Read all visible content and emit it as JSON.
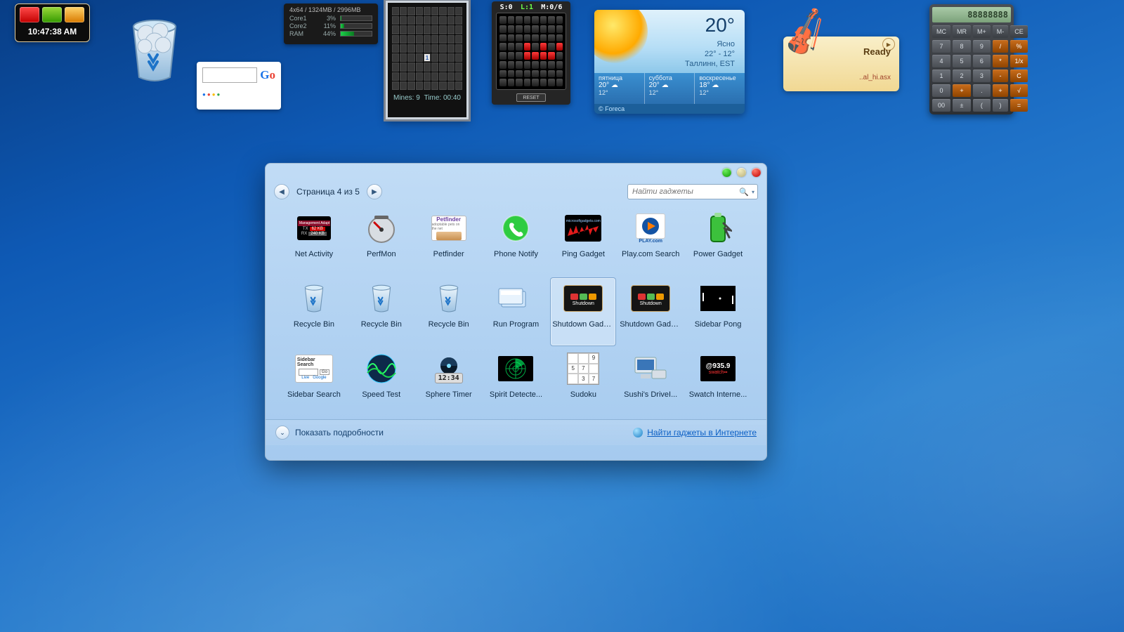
{
  "shutdown": {
    "clock": "10:47:38 AM"
  },
  "cpu": {
    "title": "4x64 / 1324MB / 2996MB",
    "rows": [
      {
        "label": "Core1",
        "pct": "3%",
        "w": 3
      },
      {
        "label": "Core2",
        "pct": "11%",
        "w": 11
      },
      {
        "label": "RAM",
        "pct": "44%",
        "w": 44
      }
    ]
  },
  "google": {
    "go_text": "Go"
  },
  "mines": {
    "revealed_value": "1",
    "mines_label": "Mines: 9",
    "time_label": "Time: 00:40"
  },
  "brick": {
    "score": "S:0",
    "level": "L:1",
    "moves": "M:0/6",
    "reset": "RESET",
    "hits": [
      27,
      29,
      31,
      35,
      36,
      37,
      38
    ]
  },
  "weather": {
    "temp": "20°",
    "cond": "Ясно",
    "range": "22°  - 12°",
    "city": "Таллинн, EST",
    "days": [
      {
        "name": "пятница",
        "hi": "20°",
        "lo": "12°"
      },
      {
        "name": "суббота",
        "hi": "20°",
        "lo": "12°"
      },
      {
        "name": "воскресенье",
        "hi": "18°",
        "lo": "12°"
      }
    ],
    "credit": "© Foreca"
  },
  "music": {
    "status": "Ready",
    "track": "..al_hi.asx"
  },
  "calc": {
    "display": "88888888",
    "keys": [
      {
        "t": "MC"
      },
      {
        "t": "MR"
      },
      {
        "t": "M+"
      },
      {
        "t": "M-"
      },
      {
        "t": "CE"
      },
      {
        "t": "7",
        "d": 1
      },
      {
        "t": "8",
        "d": 1
      },
      {
        "t": "9",
        "d": 1
      },
      {
        "t": "/",
        "o": 1
      },
      {
        "t": "%",
        "o": 1
      },
      {
        "t": "4",
        "d": 1
      },
      {
        "t": "5",
        "d": 1
      },
      {
        "t": "6",
        "d": 1
      },
      {
        "t": "*",
        "o": 1
      },
      {
        "t": "1/x",
        "o": 1
      },
      {
        "t": "1",
        "d": 1
      },
      {
        "t": "2",
        "d": 1
      },
      {
        "t": "3",
        "d": 1
      },
      {
        "t": "-",
        "o": 1
      },
      {
        "t": "C",
        "o": 1
      },
      {
        "t": "0",
        "d": 1
      },
      {
        "t": "+",
        "o": 1
      },
      {
        "t": ".",
        "d": 1
      },
      {
        "t": "+",
        "o": 1
      },
      {
        "t": "√",
        "o": 1
      },
      {
        "t": "00",
        "d": 1
      },
      {
        "t": "±",
        "d": 1
      },
      {
        "t": "(",
        "d": 1
      },
      {
        "t": ")",
        "d": 1
      },
      {
        "t": "=",
        "o": 1
      }
    ]
  },
  "gallery": {
    "page_label": "Страница 4 из 5",
    "search_placeholder": "Найти гаджеты",
    "details_label": "Показать подробности",
    "online_link": "Найти гаджеты в Интернете",
    "items": [
      {
        "label": "Net Activity",
        "icon": "netactivity"
      },
      {
        "label": "PerfMon",
        "icon": "perfmon"
      },
      {
        "label": "Petfinder",
        "icon": "petfinder"
      },
      {
        "label": "Phone Notify",
        "icon": "phone"
      },
      {
        "label": "Ping Gadget",
        "icon": "ping"
      },
      {
        "label": "Play.com Search",
        "icon": "playcom"
      },
      {
        "label": "Power Gadget",
        "icon": "battery"
      },
      {
        "label": "Recycle Bin",
        "icon": "bin"
      },
      {
        "label": "Recycle Bin",
        "icon": "bin"
      },
      {
        "label": "Recycle Bin",
        "icon": "bin"
      },
      {
        "label": "Run Program",
        "icon": "run"
      },
      {
        "label": "Shutdown Gadget",
        "icon": "shutdown",
        "selected": true
      },
      {
        "label": "Shutdown Gadget",
        "icon": "shutdown"
      },
      {
        "label": "Sidebar Pong",
        "icon": "pong"
      },
      {
        "label": "Sidebar Search",
        "icon": "sbsearch"
      },
      {
        "label": "Speed Test",
        "icon": "speed"
      },
      {
        "label": "Sphere Timer",
        "icon": "timer"
      },
      {
        "label": "Spirit Detecter Gadget",
        "icon": "radar"
      },
      {
        "label": "Sudoku",
        "icon": "sudoku"
      },
      {
        "label": "Sushi's DriveInfo",
        "icon": "drive"
      },
      {
        "label": "Swatch Internet Time",
        "icon": "swatch",
        "swatch": "@935.9"
      }
    ]
  }
}
